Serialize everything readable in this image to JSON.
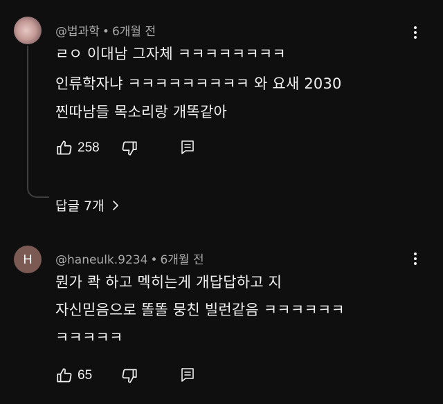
{
  "comments": [
    {
      "author": "@법과학",
      "time": "6개월 전",
      "lines": [
        "ㄹㅇ 이대남 그자체 ㅋㅋㅋㅋㅋㅋㅋㅋ",
        "인류학자냐 ㅋㅋㅋㅋㅋㅋㅋㅋㅋ 와 요새 2030",
        "찐따남들 목소리랑 개똑같아"
      ],
      "likes": "258",
      "replies_label": "답글 7개"
    },
    {
      "author": "@haneulk.9234",
      "time": "6개월 전",
      "avatar_letter": "H",
      "avatar_color": "#7a5a52",
      "lines": [
        "뭔가 콱 하고 멕히는게 개답답하고 지",
        "자신믿음으로 똘똘 뭉친 빌런같음 ㅋㅋㅋㅋㅋㅋ",
        "ㅋㅋㅋㅋㅋ"
      ],
      "likes": "65"
    }
  ],
  "icons": [
    "thumbs-up-icon",
    "thumbs-down-icon",
    "reply-icon",
    "more-vert-icon",
    "chevron-right-icon"
  ],
  "colors": {
    "background": "#0f0f0f",
    "text": "#f1f1f1",
    "meta": "#aaaaaa",
    "thread": "#3f3f3f"
  }
}
